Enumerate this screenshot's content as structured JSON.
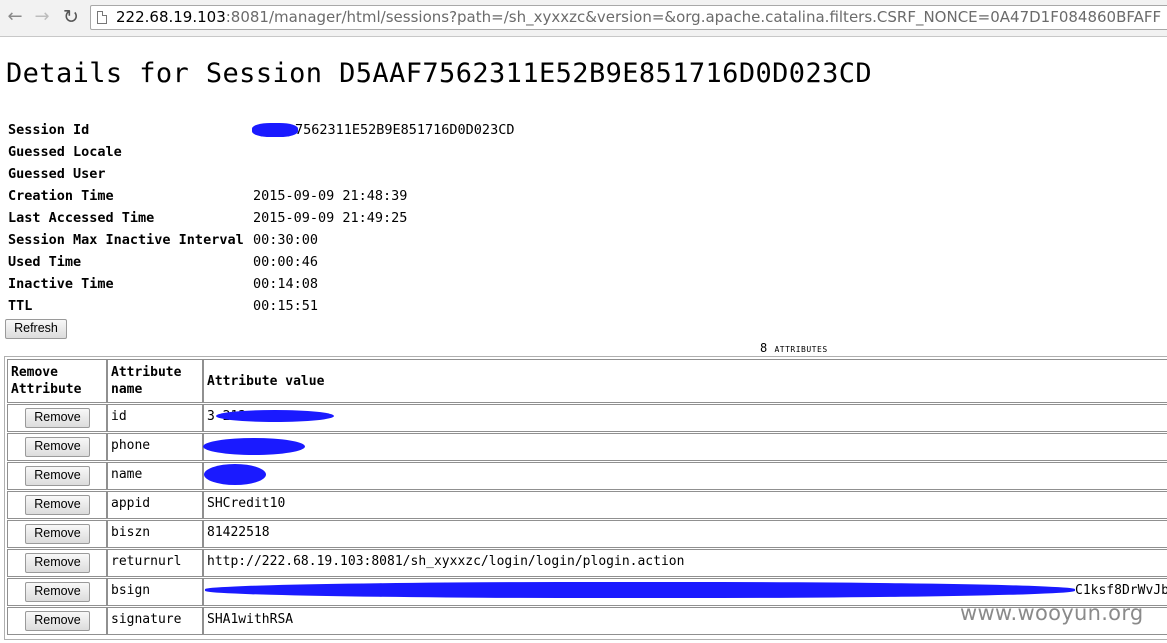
{
  "browser": {
    "url_host": "222.68.19.103",
    "url_rest": ":8081/manager/html/sessions?path=/sh_xyxxzc&version=&org.apache.catalina.filters.CSRF_NONCE=0A47D1F084860BFAFF"
  },
  "page": {
    "title": "Details for Session D5AAF7562311E52B9E851716D0D023CD"
  },
  "details": [
    {
      "label": "Session Id",
      "value": "7562311E52B9E851716D0D023CD"
    },
    {
      "label": "Guessed Locale",
      "value": ""
    },
    {
      "label": "Guessed User",
      "value": ""
    },
    {
      "label": "Creation Time",
      "value": "2015-09-09 21:48:39"
    },
    {
      "label": "Last Accessed Time",
      "value": "2015-09-09 21:49:25"
    },
    {
      "label": "Session Max Inactive Interval",
      "value": "00:30:00"
    },
    {
      "label": "Used Time",
      "value": "00:00:46"
    },
    {
      "label": "Inactive Time",
      "value": "00:14:08"
    },
    {
      "label": "TTL",
      "value": "00:15:51"
    }
  ],
  "refresh_label": "Refresh",
  "attributes": {
    "count": "8",
    "count_label": "ATTRIBUTES",
    "headers": {
      "remove_line1": "Remove",
      "remove_line2": "Attribute",
      "name_line1": "Attribute",
      "name_line2": "name",
      "value": "Attribute value"
    },
    "remove_label": "Remove",
    "rows": [
      {
        "name": "id",
        "value": "3            213"
      },
      {
        "name": "phone",
        "value": ""
      },
      {
        "name": "name",
        "value": ""
      },
      {
        "name": "appid",
        "value": "SHCredit10"
      },
      {
        "name": "biszn",
        "value": "81422518"
      },
      {
        "name": "returnurl",
        "value": "http://222.68.19.103:8081/sh_xyxxzc/login/login/plogin.action"
      },
      {
        "name": "bsign",
        "value": "C1ksf8DrWvJb"
      },
      {
        "name": "signature",
        "value": "SHA1withRSA"
      }
    ]
  },
  "watermark": "www.wooyun.org",
  "colors": {
    "redaction": "#1a1aff"
  }
}
